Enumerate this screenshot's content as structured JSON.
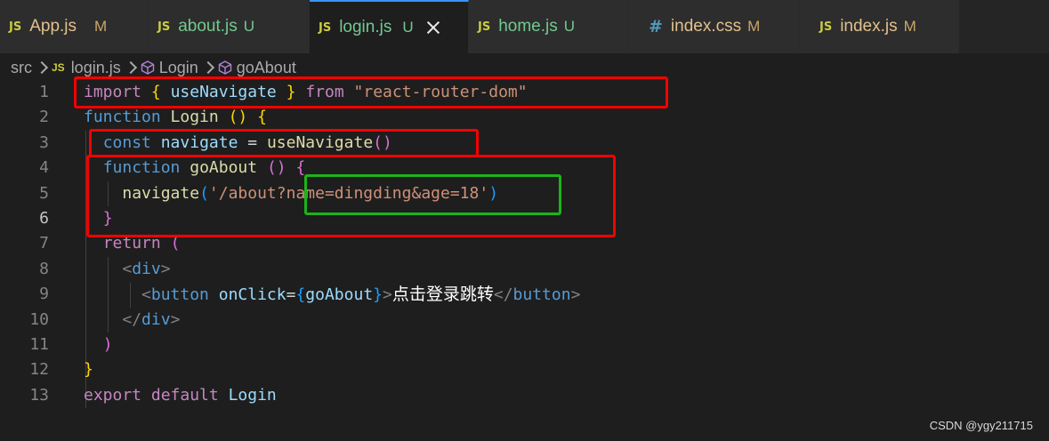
{
  "tabs": [
    {
      "type": "JS",
      "name": "App.js",
      "status": "M",
      "untracked": false
    },
    {
      "type": "JS",
      "name": "about.js",
      "status": "U",
      "untracked": true
    },
    {
      "type": "JS",
      "name": "login.js",
      "status": "U",
      "untracked": true
    },
    {
      "type": "JS",
      "name": "home.js",
      "status": "U",
      "untracked": true
    },
    {
      "type": "#",
      "name": "index.css",
      "status": "M",
      "untracked": false
    },
    {
      "type": "JS",
      "name": "index.js",
      "status": "M",
      "untracked": false
    }
  ],
  "active_tab": "login.js",
  "breadcrumb": {
    "folder": "src",
    "file_icon": "JS",
    "file": "login.js",
    "symbol1": "Login",
    "symbol2": "goAbout"
  },
  "line_numbers": [
    "1",
    "2",
    "3",
    "4",
    "5",
    "6",
    "7",
    "8",
    "9",
    "10",
    "11",
    "12",
    "13"
  ],
  "current_line": "6",
  "code": {
    "l1": {
      "kw": "import",
      "b1": "{",
      "name": "useNavigate",
      "b2": "}",
      "from": "from",
      "module": "\"react-router-dom\""
    },
    "l2": {
      "kw": "function",
      "name": "Login",
      "parens": "()",
      "brace": "{"
    },
    "l3": {
      "kw": "const",
      "name": "navigate",
      "eq": "=",
      "call": "useNavigate",
      "parens": "()"
    },
    "l4": {
      "kw": "function",
      "name": "goAbout",
      "parens": "()",
      "brace": "{"
    },
    "l5": {
      "call": "navigate",
      "open": "(",
      "str1": "'/about",
      "str2": "?name=dingding&age=18",
      "str3": "'",
      "close": ")"
    },
    "l6": {
      "brace": "}"
    },
    "l7": {
      "kw": "return",
      "paren": "("
    },
    "l8": {
      "open": "<",
      "tag": "div",
      "close": ">"
    },
    "l9": {
      "open": "<",
      "tag": "button",
      "attr": "onClick",
      "eq": "=",
      "b1": "{",
      "handler": "goAbout",
      "b2": "}",
      "gt": ">",
      "text": "点击登录跳转",
      "endopen": "</",
      "endtag": "button",
      "endclose": ">"
    },
    "l10": {
      "open": "</",
      "tag": "div",
      "close": ">"
    },
    "l11": {
      "paren": ")"
    },
    "l12": {
      "brace": "}"
    },
    "l13": {
      "kw1": "export",
      "kw2": "default",
      "name": "Login"
    }
  },
  "watermark": "CSDN @ygy211715",
  "colors": {
    "annotation_red": "#f40000",
    "annotation_green": "#1cb418",
    "active_tab_border": "#3794ff"
  }
}
